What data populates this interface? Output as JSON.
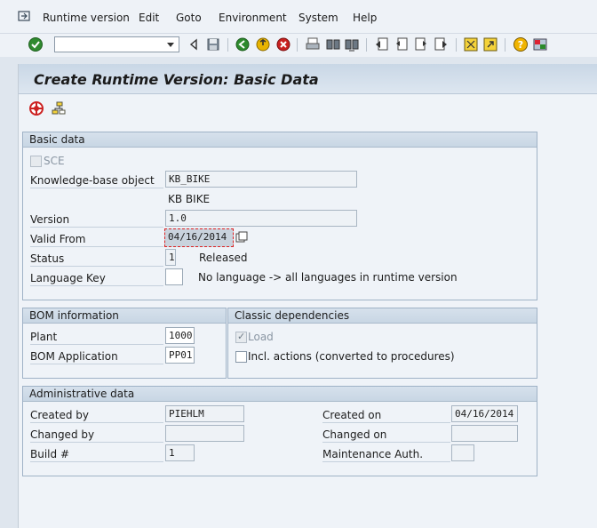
{
  "menubar": {
    "items": [
      "Runtime version",
      "Edit",
      "Goto",
      "Environment",
      "System",
      "Help"
    ]
  },
  "toolbar": {
    "command_value": "",
    "icons": [
      "enter-icon",
      "back-icon",
      "save-icon",
      "navigate-back-icon",
      "exit-icon",
      "cancel-icon",
      "print-icon",
      "find-icon",
      "find-next-icon",
      "first-page-icon",
      "previous-page-icon",
      "next-page-icon",
      "last-page-icon",
      "new-session-icon",
      "shortcut-icon",
      "help-icon",
      "layout-icon"
    ]
  },
  "page": {
    "title": "Create Runtime Version: Basic Data"
  },
  "basic_data": {
    "header": "Basic data",
    "sce_label": "SCE",
    "kb_object_label": "Knowledge-base object",
    "kb_object_value": "KB_BIKE",
    "kb_object_desc": "KB BIKE",
    "version_label": "Version",
    "version_value": "1.0",
    "valid_from_label": "Valid From",
    "valid_from_value": "04/16/2014",
    "status_label": "Status",
    "status_value": "1",
    "status_text": "Released",
    "language_label": "Language Key",
    "language_value": "",
    "language_text": "No language -> all languages in runtime version"
  },
  "bom_info": {
    "header": "BOM information",
    "plant_label": "Plant",
    "plant_value": "1000",
    "bom_app_label": "BOM Application",
    "bom_app_value": "PP01"
  },
  "classic_dependencies": {
    "header": "Classic dependencies",
    "load_label": "Load",
    "load_checked": true,
    "incl_actions_label": "Incl. actions (converted to procedures)",
    "incl_actions_checked": false
  },
  "admin_data": {
    "header": "Administrative data",
    "created_by_label": "Created by",
    "created_by_value": "PIEHLM",
    "changed_by_label": "Changed by",
    "changed_by_value": "",
    "build_label": "Build #",
    "build_value": "1",
    "created_on_label": "Created on",
    "created_on_value": "04/16/2014",
    "changed_on_label": "Changed on",
    "changed_on_value": "",
    "maint_auth_label": "Maintenance Auth.",
    "maint_auth_value": ""
  },
  "colors": {
    "title_band": "#c9d7e6",
    "group_border": "#9fb2c6",
    "focus_border": "#dd2222"
  }
}
